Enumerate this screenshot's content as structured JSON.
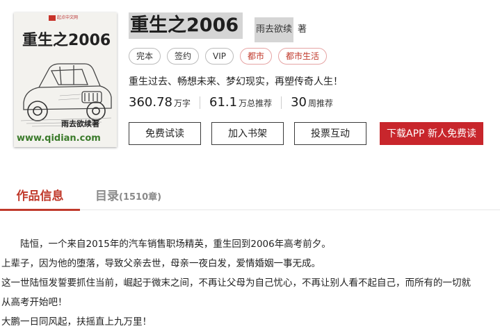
{
  "cover": {
    "logo_text": "起点中文网",
    "title": "重生之2006",
    "author": "雨去欲续著",
    "url": "www.qidian.com"
  },
  "book": {
    "title": "重生之2006",
    "author": "雨去欲续",
    "author_role": "著",
    "tags": [
      "完本",
      "签约",
      "VIP",
      "都市",
      "都市生活"
    ],
    "intro": "重生过去、畅想未来、梦幻现实，再塑传奇人生！",
    "stats": [
      {
        "value": "360.78",
        "unit": "万字"
      },
      {
        "value": "61.1",
        "unit": "万总推荐"
      },
      {
        "value": "30",
        "unit": "周推荐"
      }
    ]
  },
  "actions": {
    "read_free": "免费试读",
    "add_shelf": "加入书架",
    "vote": "投票互动",
    "download": "下载APP 新人免费读"
  },
  "tabs": {
    "info": "作品信息",
    "catalog": "目录",
    "catalog_count": "(1510章)"
  },
  "description": [
    "陆恒，一个来自2015年的汽车销售职场精英，重生回到2006年高考前夕。",
    "上辈子，因为他的堕落，导致父亲去世，母亲一夜白发，爱情婚姻一事无成。",
    "这一世陆恒发誓要抓住当前，崛起于微末之间，不再让父母为自己忧心，不再让别人看不起自己，而所有的一切就",
    "从高考开始吧！",
    "大鹏一日同风起，扶摇直上九万里！"
  ]
}
